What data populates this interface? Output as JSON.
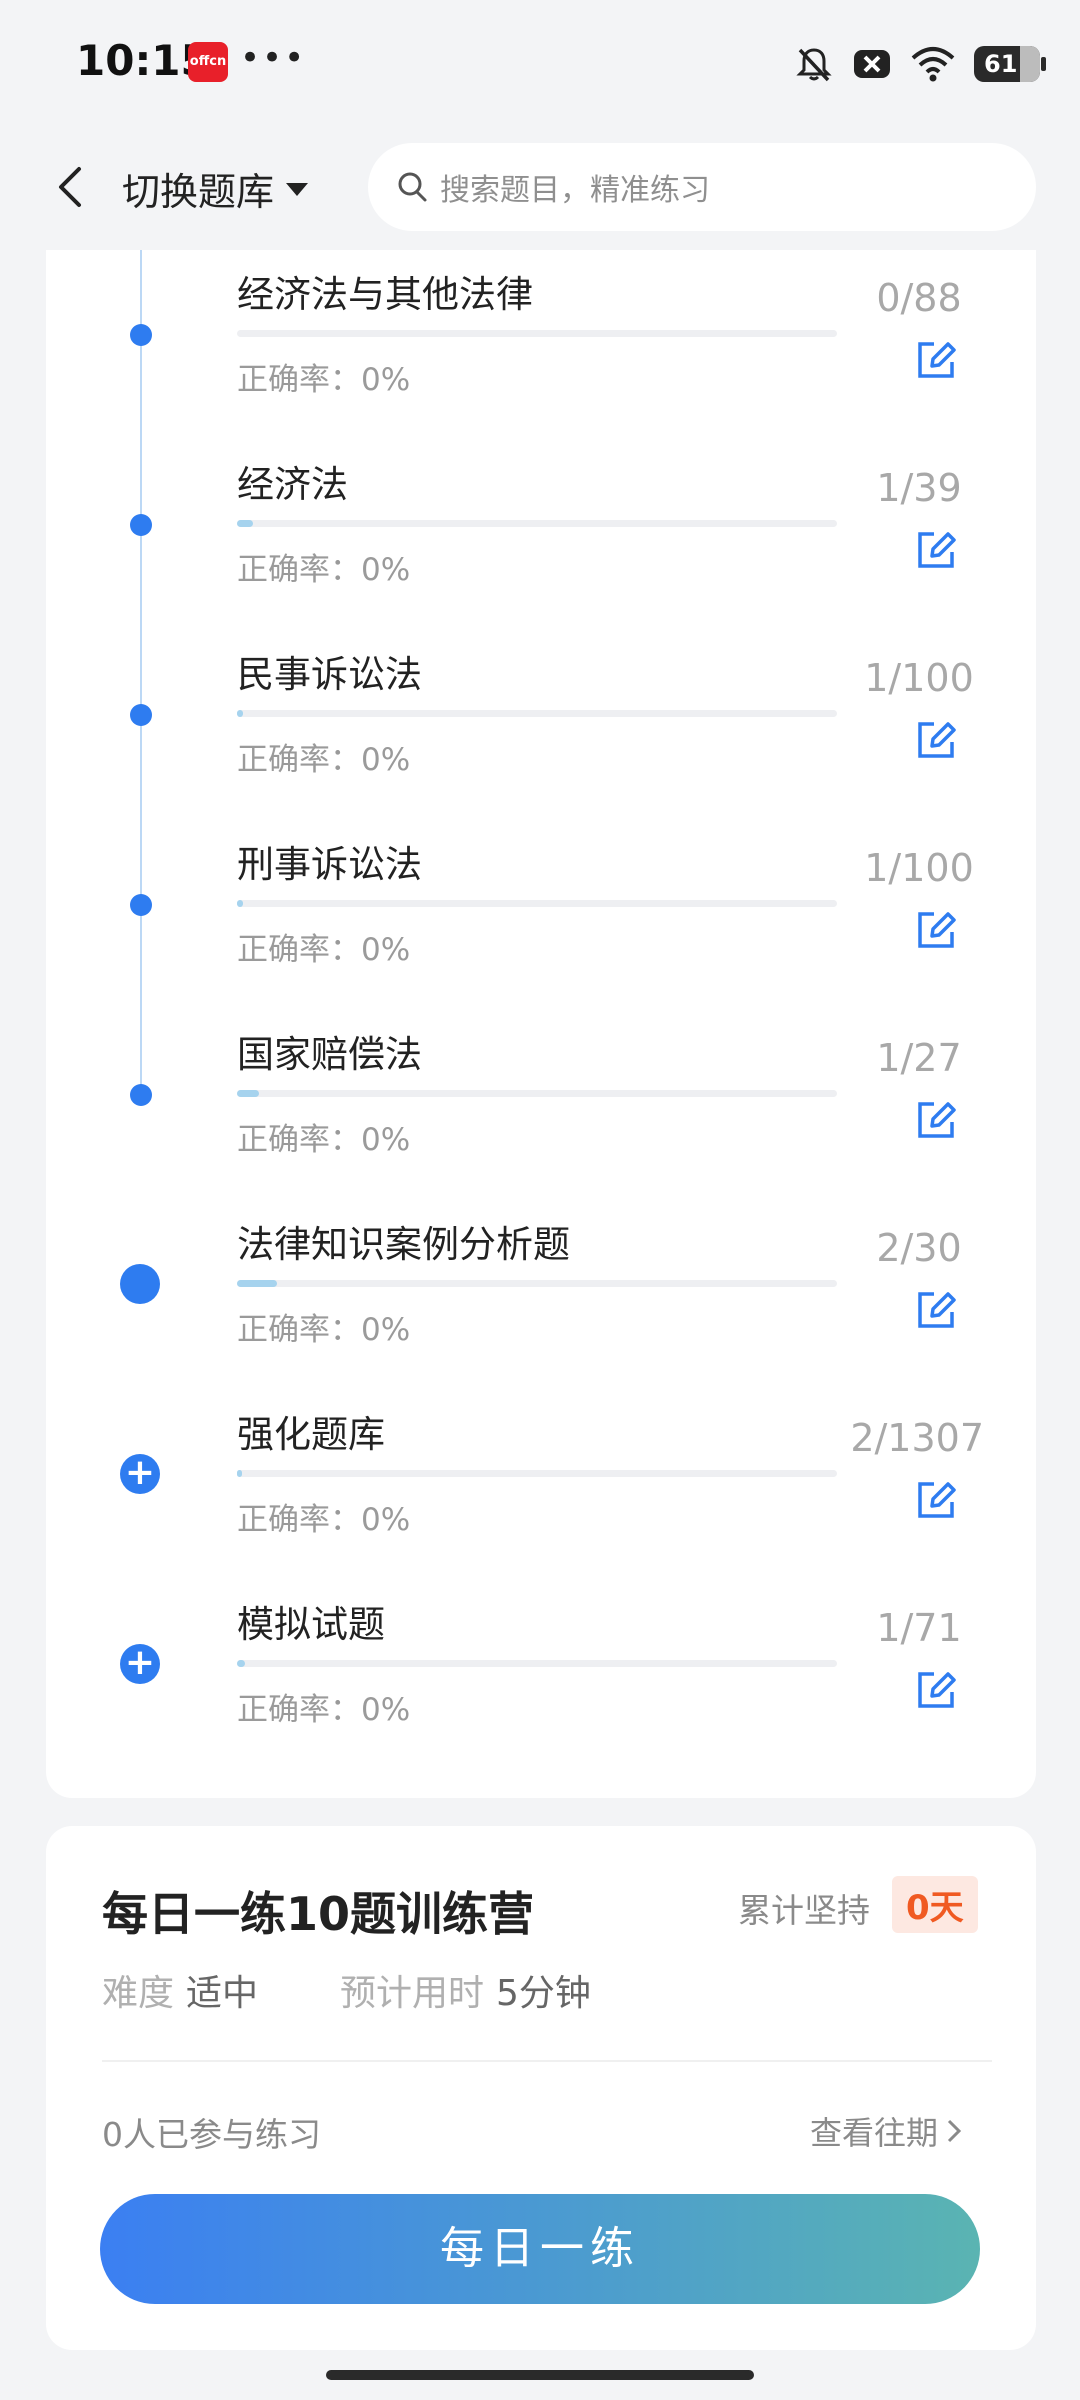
{
  "status_bar": {
    "time": "10:15",
    "app_badge": "offcn",
    "more": "•••",
    "battery": "61"
  },
  "header": {
    "switch_label": "切换题库",
    "search_placeholder": "搜索题目，精准练习"
  },
  "accuracy_prefix": "正确率：",
  "items": [
    {
      "title": "经济法与其他法律",
      "count": "0/88",
      "accuracy": "0%",
      "progress": 0.0,
      "marker": "dot"
    },
    {
      "title": "经济法",
      "count": "1/39",
      "accuracy": "0%",
      "progress": 0.026,
      "marker": "dot"
    },
    {
      "title": "民事诉讼法",
      "count": "1/100",
      "accuracy": "0%",
      "progress": 0.01,
      "marker": "dot"
    },
    {
      "title": "刑事诉讼法",
      "count": "1/100",
      "accuracy": "0%",
      "progress": 0.01,
      "marker": "dot"
    },
    {
      "title": "国家赔偿法",
      "count": "1/27",
      "accuracy": "0%",
      "progress": 0.037,
      "marker": "dot"
    },
    {
      "title": "法律知识案例分析题",
      "count": "2/30",
      "accuracy": "0%",
      "progress": 0.067,
      "marker": "big-dot"
    },
    {
      "title": "强化题库",
      "count": "2/1307",
      "accuracy": "0%",
      "progress": 0.0015,
      "marker": "plus"
    },
    {
      "title": "模拟试题",
      "count": "1/71",
      "accuracy": "0%",
      "progress": 0.014,
      "marker": "plus"
    }
  ],
  "daily": {
    "title": "每日一练10题训练营",
    "streak_label": "累计坚持",
    "streak_value": "0天",
    "difficulty_label": "难度",
    "difficulty_value": "适中",
    "time_label": "预计用时",
    "time_value": "5分钟",
    "participants": "0人已参与练习",
    "history_link": "查看往期",
    "button": "每日一练"
  },
  "colors": {
    "accent": "#2e7cf0",
    "progress": "#a6d3ee",
    "streak": "#f05a22"
  }
}
